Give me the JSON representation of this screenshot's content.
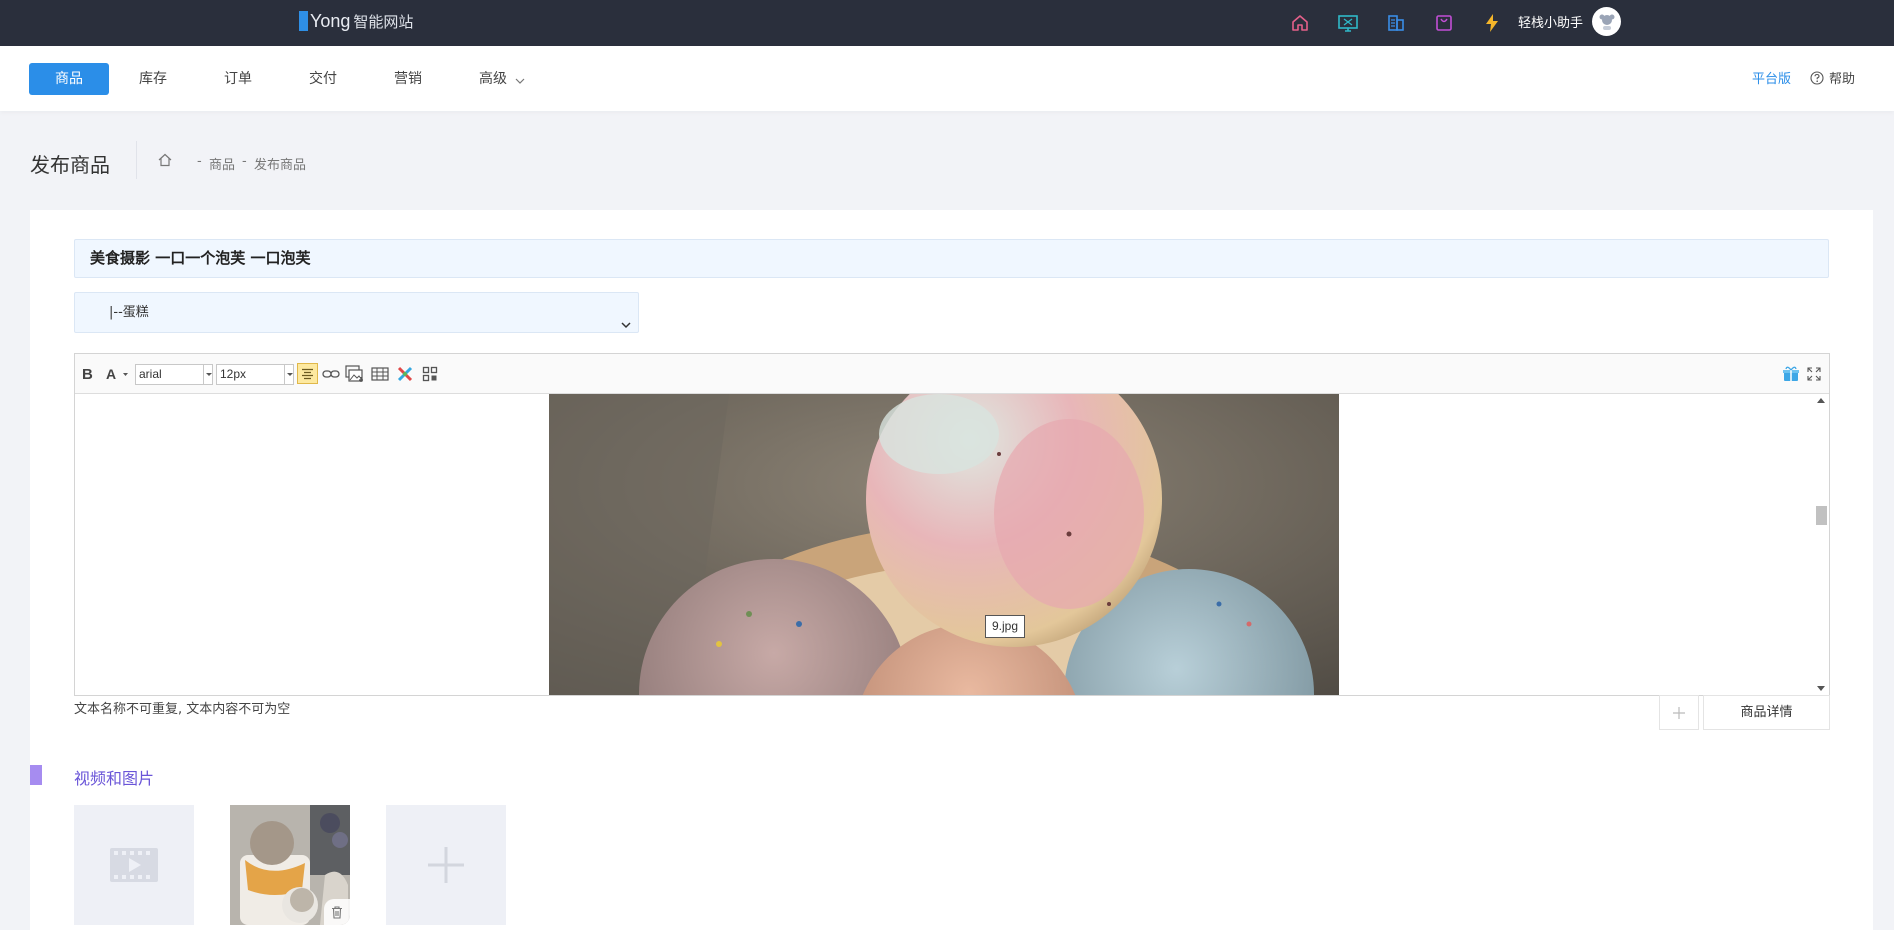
{
  "topbar": {
    "logo_main": "Yong",
    "logo_sub": "智能网站",
    "icons": [
      "home-icon",
      "monitor-icon",
      "building-icon",
      "shopping-bag-icon",
      "lightning-icon"
    ],
    "user_name": "轻栈小助手"
  },
  "nav": {
    "items": [
      {
        "label": "商品",
        "active": true
      },
      {
        "label": "库存"
      },
      {
        "label": "订单"
      },
      {
        "label": "交付"
      },
      {
        "label": "营销"
      },
      {
        "label": "高级"
      }
    ],
    "platform": "平台版",
    "help": "帮助"
  },
  "page": {
    "title": "发布商品",
    "breadcrumb": [
      "商品",
      "发布商品"
    ]
  },
  "form": {
    "product_title": "美食摄影 一口一个泡芙 一口泡芙",
    "category": "|--蛋糕"
  },
  "editor": {
    "font_family": "arial",
    "font_size": "12px",
    "image_tooltip": "9.jpg",
    "hint": "文本名称不可重复, 文本内容不可为空",
    "detail_tab": "商品详情"
  },
  "media": {
    "section_title": "视频和图片"
  },
  "colors": {
    "topbar": "#2a2f3c",
    "accent": "#2b8ee8",
    "section": "#6a55d8"
  }
}
